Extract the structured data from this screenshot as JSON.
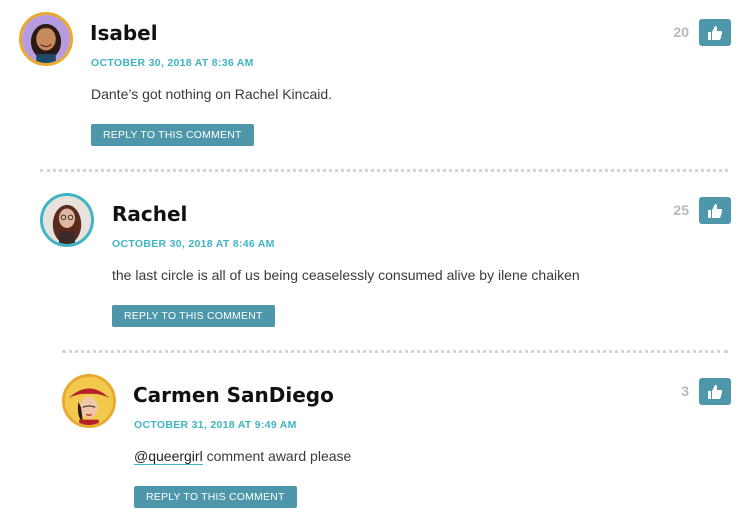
{
  "comments": [
    {
      "author": "Isabel",
      "date": "OCTOBER 30, 2018 AT 8:36 AM",
      "text": "Dante’s got nothing on Rachel Kincaid.",
      "likes": "20",
      "reply_label": "REPLY TO THIS COMMENT"
    },
    {
      "author": "Rachel",
      "date": "OCTOBER 30, 2018 AT 8:46 AM",
      "text": "the last circle is all of us being ceaselessly consumed alive by ilene chaiken",
      "likes": "25",
      "reply_label": "REPLY TO THIS COMMENT"
    },
    {
      "author": "Carmen SanDiego",
      "date": "OCTOBER 31, 2018 AT 9:49 AM",
      "mention": "@queergirl",
      "text": " comment award please",
      "likes": "3",
      "reply_label": "REPLY TO THIS COMMENT"
    }
  ],
  "colors": {
    "accent": "#4e97ab",
    "date": "#3fb4c5",
    "avatar_ring_gold": "#e9a92f",
    "avatar_ring_teal": "#3fb4c5"
  },
  "icons": {
    "like": "thumbs-up-icon"
  }
}
